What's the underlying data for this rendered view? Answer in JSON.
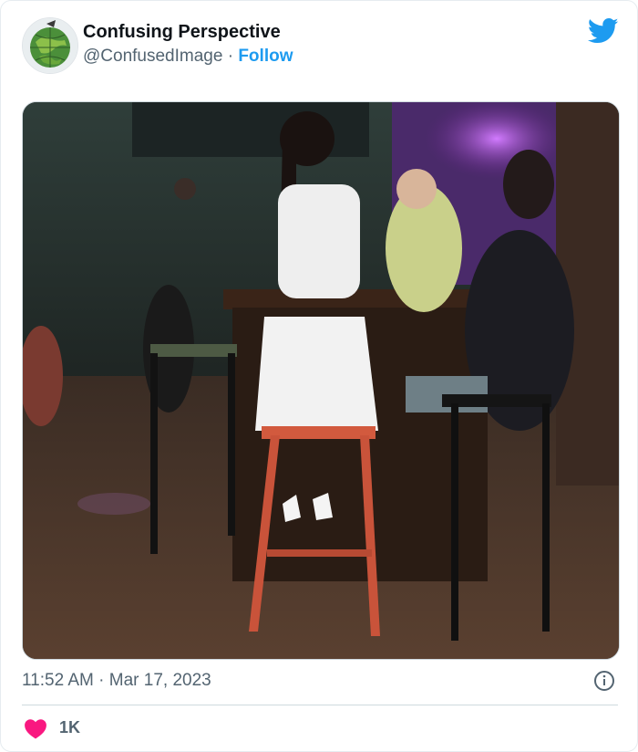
{
  "tweet": {
    "author": {
      "display_name": "Confusing Perspective",
      "handle": "@ConfusedImage",
      "separator": "·",
      "follow_label": "Follow"
    },
    "timestamp": "11:52 AM · Mar 17, 2023",
    "likes": "1K"
  },
  "colors": {
    "brand_blue": "#1d9bf0",
    "heart_pink": "#f91880",
    "text_primary": "#0f1419",
    "text_secondary": "#536471"
  },
  "icons": {
    "platform": "twitter-bird-icon",
    "info": "info-icon",
    "like": "heart-icon"
  }
}
